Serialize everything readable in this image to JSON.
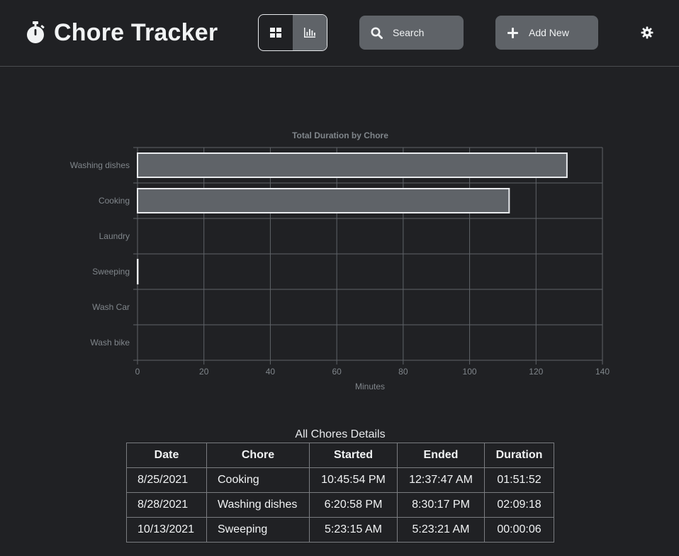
{
  "app": {
    "title": "Chore Tracker",
    "brand_icon": "stopwatch-icon"
  },
  "toolbar": {
    "view_options": [
      {
        "name": "grid-view",
        "icon": "grid-icon",
        "active": false
      },
      {
        "name": "chart-view",
        "icon": "bar-chart-icon",
        "active": true
      }
    ],
    "search_label": "Search",
    "add_label": "Add New",
    "theme_icon": "gear-icon"
  },
  "colors": {
    "background": "#202124",
    "button": "#5f6368",
    "bar_fill": "#5f6368",
    "bar_border": "#e8eaed",
    "grid": "#5f6368",
    "muted_text": "#80868b"
  },
  "chart_data": {
    "type": "bar",
    "orientation": "horizontal",
    "title": "Total Duration by Chore",
    "xlabel": "Minutes",
    "ylabel": "",
    "categories": [
      "Washing dishes",
      "Cooking",
      "Laundry",
      "Sweeping",
      "Wash Car",
      "Wash bike"
    ],
    "values": [
      129.3,
      111.9,
      0,
      0.1,
      0,
      0
    ],
    "xlim": [
      0,
      140
    ],
    "xticks": [
      "0",
      "20",
      "40",
      "60",
      "80",
      "100",
      "120",
      "140"
    ],
    "grid": true,
    "legend": "none"
  },
  "details": {
    "caption": "All Chores Details",
    "columns": [
      "Date",
      "Chore",
      "Started",
      "Ended",
      "Duration"
    ],
    "rows": [
      [
        "8/25/2021",
        "Cooking",
        "10:45:54 PM",
        "12:37:47 AM",
        "01:51:52"
      ],
      [
        "8/28/2021",
        "Washing dishes",
        "6:20:58 PM",
        "8:30:17 PM",
        "02:09:18"
      ],
      [
        "10/13/2021",
        "Sweeping",
        "5:23:15 AM",
        "5:23:21 AM",
        "00:00:06"
      ]
    ]
  }
}
